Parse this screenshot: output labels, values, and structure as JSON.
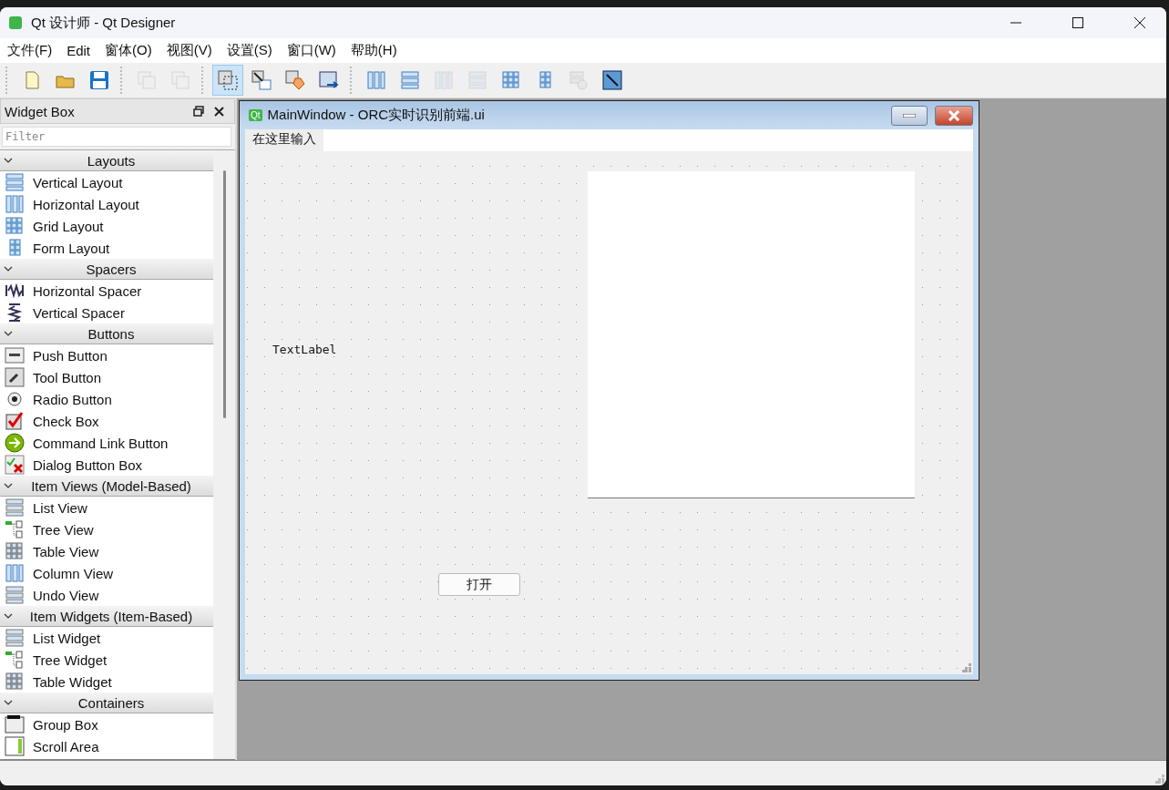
{
  "window": {
    "title": "Qt 设计师 - Qt Designer"
  },
  "menu": [
    "文件(F)",
    "Edit",
    "窗体(O)",
    "视图(V)",
    "设置(S)",
    "窗口(W)",
    "帮助(H)"
  ],
  "toolbar": [
    {
      "items": [
        {
          "kind": "new",
          "selected": false,
          "disabled": false
        },
        {
          "kind": "open",
          "selected": false,
          "disabled": false
        },
        {
          "kind": "save",
          "selected": false,
          "disabled": false
        }
      ]
    },
    {
      "items": [
        {
          "kind": "front",
          "selected": false,
          "disabled": true
        },
        {
          "kind": "back",
          "selected": false,
          "disabled": true
        }
      ]
    },
    {
      "items": [
        {
          "kind": "widgets",
          "selected": true,
          "disabled": false
        },
        {
          "kind": "signals",
          "selected": false,
          "disabled": false
        },
        {
          "kind": "buddies",
          "selected": false,
          "disabled": false
        },
        {
          "kind": "taborder",
          "selected": false,
          "disabled": false
        }
      ]
    },
    {
      "items": [
        {
          "kind": "hlayout",
          "selected": false,
          "disabled": false
        },
        {
          "kind": "vlayout",
          "selected": false,
          "disabled": false
        },
        {
          "kind": "hsplit",
          "selected": false,
          "disabled": true
        },
        {
          "kind": "vsplit",
          "selected": false,
          "disabled": true
        },
        {
          "kind": "grid",
          "selected": false,
          "disabled": false
        },
        {
          "kind": "form",
          "selected": false,
          "disabled": false
        },
        {
          "kind": "break",
          "selected": false,
          "disabled": true
        },
        {
          "kind": "adjust",
          "selected": false,
          "disabled": false
        }
      ]
    }
  ],
  "widget_box": {
    "title": "Widget Box",
    "filter": {
      "placeholder": "Filter"
    },
    "categories": [
      {
        "name": "Layouts",
        "expanded": true,
        "items": [
          {
            "label": "Vertical Layout",
            "kind": "vlayout"
          },
          {
            "label": "Horizontal Layout",
            "kind": "hlayout"
          },
          {
            "label": "Grid Layout",
            "kind": "grid"
          },
          {
            "label": "Form Layout",
            "kind": "form"
          }
        ]
      },
      {
        "name": "Spacers",
        "expanded": true,
        "items": [
          {
            "label": "Horizontal Spacer",
            "kind": "hspacer"
          },
          {
            "label": "Vertical Spacer",
            "kind": "vspacer"
          }
        ]
      },
      {
        "name": "Buttons",
        "expanded": true,
        "items": [
          {
            "label": "Push Button",
            "kind": "push"
          },
          {
            "label": "Tool Button",
            "kind": "tool"
          },
          {
            "label": "Radio Button",
            "kind": "radio"
          },
          {
            "label": "Check Box",
            "kind": "check"
          },
          {
            "label": "Command Link Button",
            "kind": "command"
          },
          {
            "label": "Dialog Button Box",
            "kind": "dialog"
          }
        ]
      },
      {
        "name": "Item Views (Model-Based)",
        "expanded": true,
        "items": [
          {
            "label": "List View",
            "kind": "list"
          },
          {
            "label": "Tree View",
            "kind": "tree"
          },
          {
            "label": "Table View",
            "kind": "table"
          },
          {
            "label": "Column View",
            "kind": "column"
          },
          {
            "label": "Undo View",
            "kind": "list"
          }
        ]
      },
      {
        "name": "Item Widgets (Item-Based)",
        "expanded": true,
        "items": [
          {
            "label": "List Widget",
            "kind": "list"
          },
          {
            "label": "Tree Widget",
            "kind": "tree"
          },
          {
            "label": "Table Widget",
            "kind": "table"
          }
        ]
      },
      {
        "name": "Containers",
        "expanded": true,
        "items": [
          {
            "label": "Group Box",
            "kind": "group"
          },
          {
            "label": "Scroll Area",
            "kind": "scroll"
          }
        ]
      }
    ]
  },
  "form": {
    "badge": "Qt",
    "title": "MainWindow - ORC实时识别前端.ui",
    "menu_placeholder": "在这里输入",
    "label": "TextLabel",
    "button": "打开"
  }
}
